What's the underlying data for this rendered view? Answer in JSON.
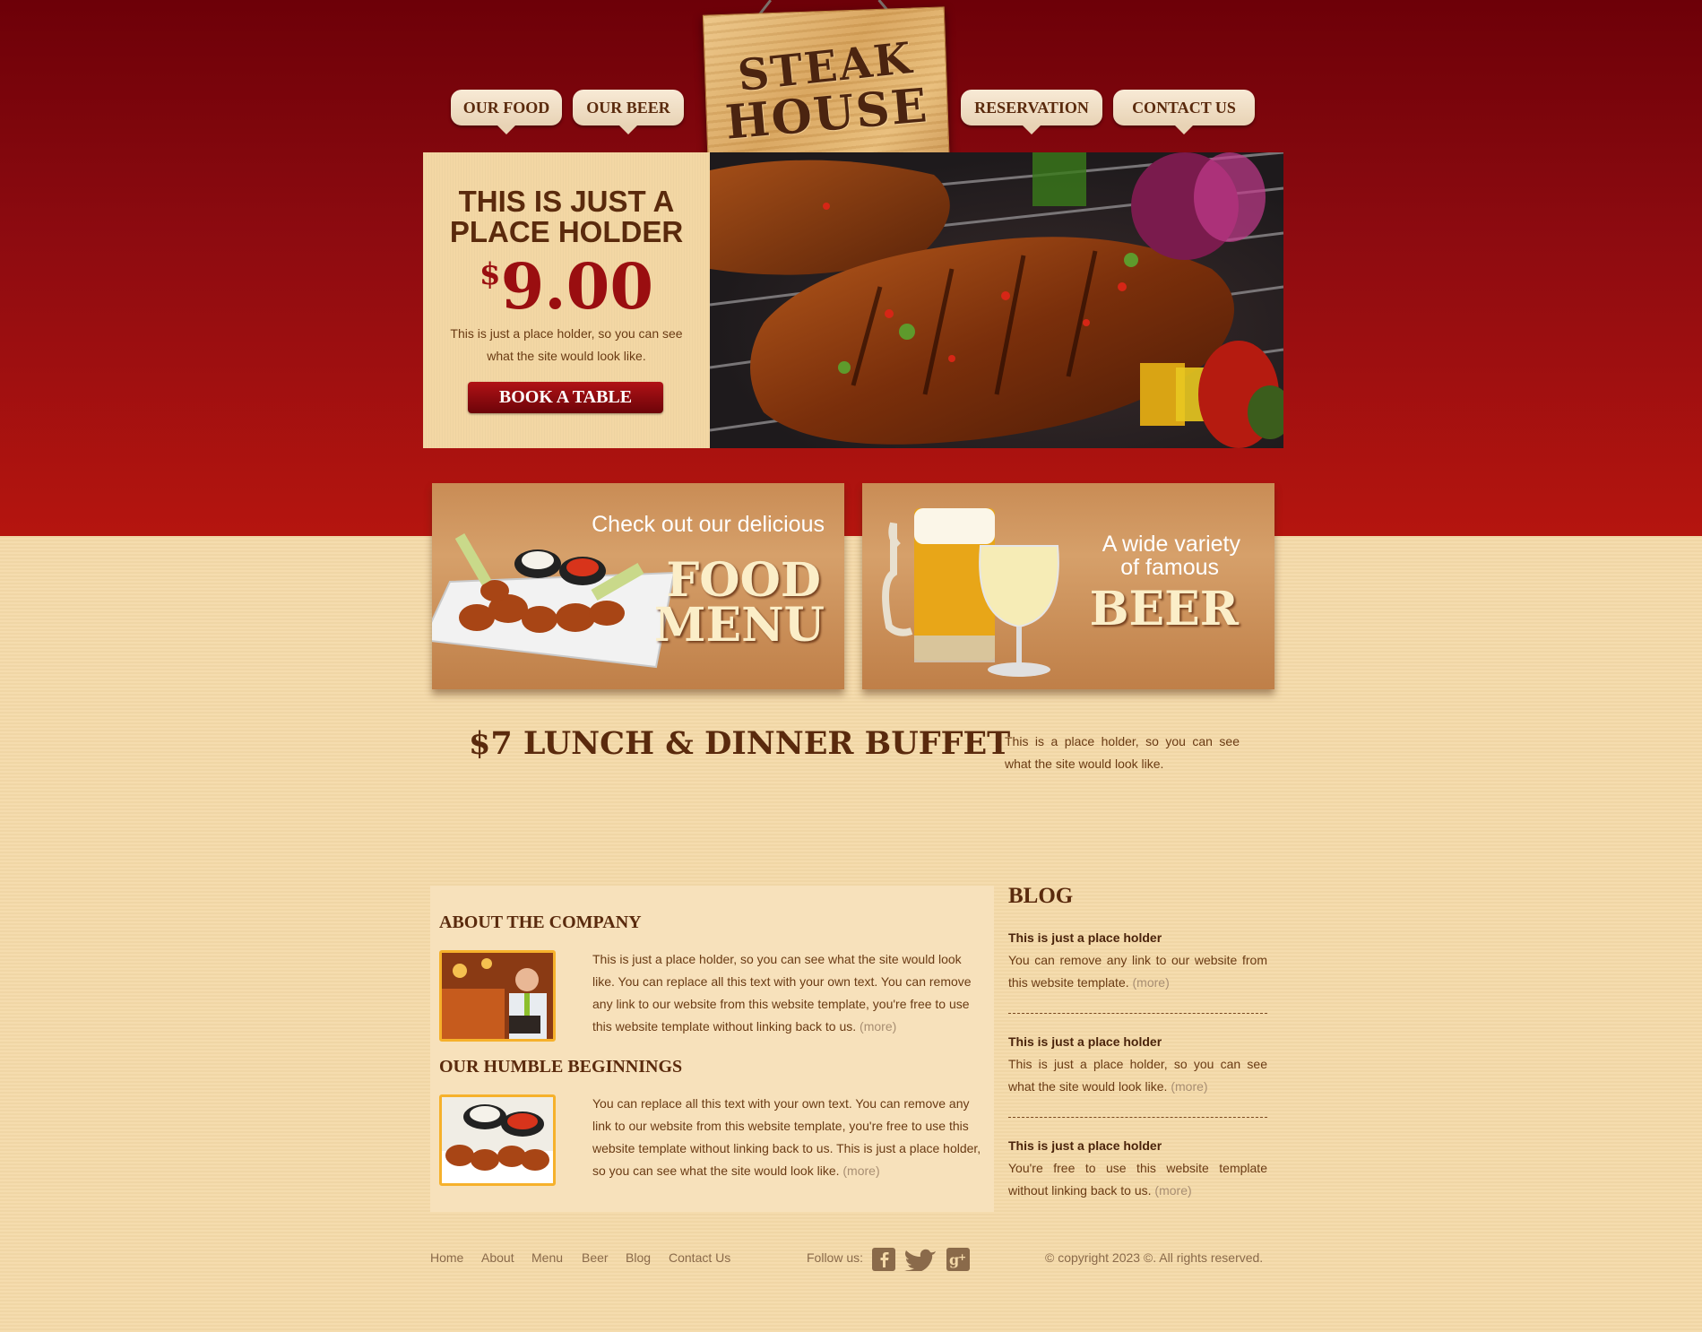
{
  "nav": {
    "our_food": "OUR FOOD",
    "our_beer": "OUR BEER",
    "reservation": "RESERVATION",
    "contact_us": "CONTACT US"
  },
  "logo": {
    "line1": "STEAK",
    "line2": "HOUSE"
  },
  "hero": {
    "title_line1": "THIS IS JUST A",
    "title_line2": "PLACE HOLDER",
    "currency": "$",
    "price": "9.00",
    "text": "This is just a place holder, so you can see what the site would look like.",
    "cta": "BOOK A TABLE"
  },
  "promos": {
    "food": {
      "small": "Check out our delicious",
      "big1": "FOOD",
      "big2": "MENU"
    },
    "beer": {
      "small1": "A wide variety",
      "small2": "of famous",
      "big": "BEER"
    }
  },
  "buffet": {
    "title": "$7 LUNCH & DINNER BUFFET",
    "text": "This is a place holder, so you can see what the site would look like."
  },
  "about": {
    "title": "ABOUT THE COMPANY",
    "text": "This is just a place holder, so you can see what the site would look like. You can replace all this text with your own text. You can remove any link to our website from this website template, you're free to use this website template without linking back to us.",
    "more": "(more)",
    "title2": "OUR HUMBLE BEGINNINGS",
    "text2": "You can replace all this text with your own text. You can remove any link to our website from this website template, you're free to use this website template without linking back to us. This is just a place holder, so you can see what the site would look like.",
    "more2": "(more)"
  },
  "blog": {
    "title": "BLOG",
    "items": [
      {
        "heading": "This is just a place holder",
        "text": "You can remove any link to our website from this website template.",
        "more": "(more)"
      },
      {
        "heading": "This is just a place holder",
        "text": "This is just a place holder, so you can see what the site would look like.",
        "more": "(more)"
      },
      {
        "heading": "This is just a place holder",
        "text": "You're free to use this website template without linking back to us.",
        "more": "(more)"
      }
    ]
  },
  "footer": {
    "links": [
      "Home",
      "About",
      "Menu",
      "Beer",
      "Blog",
      "Contact Us"
    ],
    "follow": "Follow us:",
    "social": [
      "facebook-icon",
      "twitter-icon",
      "google-plus-icon"
    ],
    "copyright": "© copyright 2023 ©. All rights reserved."
  },
  "colors": {
    "brand_red": "#9a0e10",
    "cream": "#f4d9a8",
    "brown": "#5a2a0d",
    "frame_orange": "#f6b12b"
  }
}
